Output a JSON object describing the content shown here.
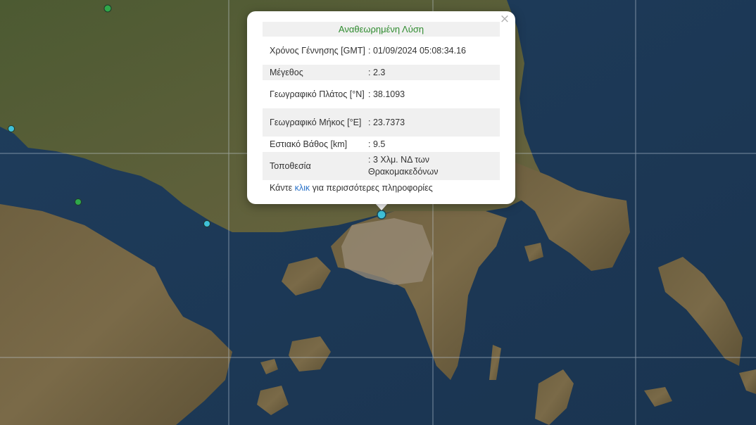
{
  "popup": {
    "title": "Αναθεωρημένη Λύση",
    "close_icon": "close-icon",
    "rows": [
      {
        "label": "Χρόνος Γέννησης [GMT]",
        "value": ": 01/09/2024 05:08:34.16"
      },
      {
        "label": "Μέγεθος",
        "value": ": 2.3"
      },
      {
        "label": "Γεωγραφικό Πλάτος [°N]",
        "value": ": 38.1093"
      },
      {
        "label": "Γεωγραφικό Μήκος [°E]",
        "value": ": 23.7373"
      },
      {
        "label": "Εστιακό Βάθος [km]",
        "value": ": 9.5"
      },
      {
        "label": "Τοποθεσία",
        "value": ": 3 Χλμ. ΝΔ των Θρακομακεδόνων"
      }
    ],
    "more_prefix": "Κάντε",
    "more_link": "κλικ",
    "more_suffix": "για περισσότερες πληροφορίες"
  },
  "colors": {
    "sea": "#1e3a55",
    "land": "#6b5a3c",
    "quake_cyan": "#3fc1d9",
    "quake_green": "#2fa84a",
    "title_green": "#2e8b2e",
    "link_blue": "#2a72c8"
  },
  "markers": [
    {
      "name": "selected-quake",
      "color": "cyan"
    },
    {
      "name": "quake-1",
      "color": "green"
    },
    {
      "name": "quake-2",
      "color": "cyan"
    },
    {
      "name": "quake-3",
      "color": "green"
    },
    {
      "name": "quake-4",
      "color": "cyan"
    }
  ]
}
